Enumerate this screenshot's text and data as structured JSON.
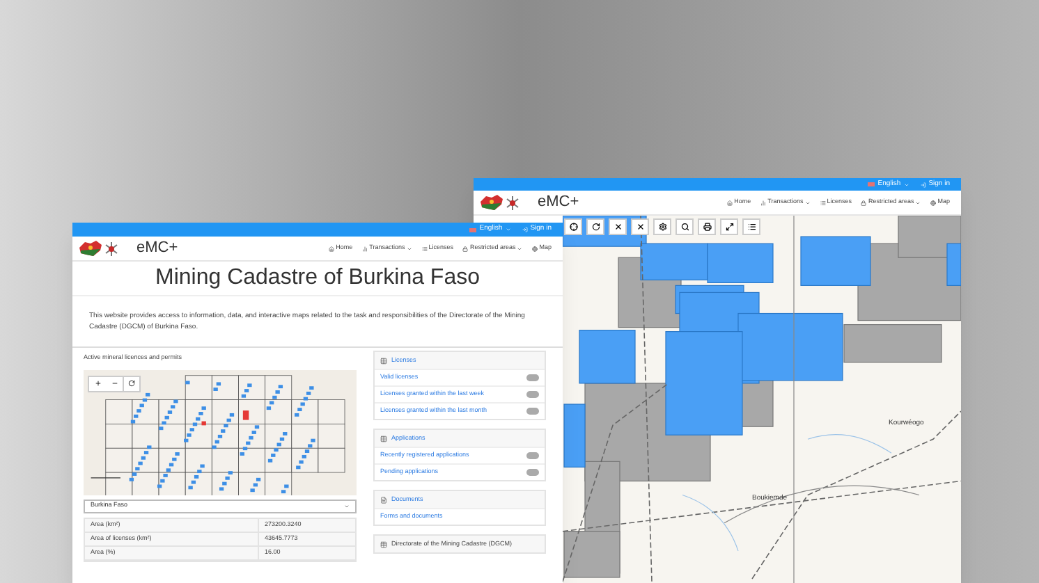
{
  "back_window": {
    "topbar": {
      "language": "English",
      "sign_in": "Sign in"
    },
    "brand": "eMC+",
    "nav": [
      {
        "label": "Home",
        "dropdown": false
      },
      {
        "label": "Transactions",
        "dropdown": true
      },
      {
        "label": "Licenses",
        "dropdown": false
      },
      {
        "label": "Restricted areas",
        "dropdown": true
      },
      {
        "label": "Map",
        "dropdown": false
      }
    ],
    "map_labels": [
      "Boukiemde",
      "Kourwéogo"
    ]
  },
  "front_window": {
    "topbar": {
      "language": "English",
      "sign_in": "Sign in"
    },
    "brand": "eMC+",
    "nav": [
      {
        "label": "Home",
        "dropdown": false
      },
      {
        "label": "Transactions",
        "dropdown": true
      },
      {
        "label": "Licenses",
        "dropdown": false
      },
      {
        "label": "Restricted areas",
        "dropdown": true
      },
      {
        "label": "Map",
        "dropdown": false
      }
    ],
    "title": "Mining Cadastre of Burkina Faso",
    "description": "This website provides access to information, data, and interactive maps related to the task and responsibilities of the Directorate of the Mining Cadastre (DGCM) of Burkina Faso.",
    "map_panel": {
      "title": "Active mineral licences and permits",
      "region_select": "Burkina Faso",
      "table": [
        {
          "label": "Area (km²)",
          "value": "273200.3240"
        },
        {
          "label": "Area of licenses (km²)",
          "value": "43645.7773"
        },
        {
          "label": "Area (%)",
          "value": "16.00"
        }
      ]
    },
    "panels": [
      {
        "title": "Licenses",
        "links": [
          {
            "label": "Valid licenses",
            "badge": true
          },
          {
            "label": "Licenses granted within the last week",
            "badge": true
          },
          {
            "label": "Licenses granted within the last month",
            "badge": true
          }
        ]
      },
      {
        "title": "Applications",
        "links": [
          {
            "label": "Recently registered applications",
            "badge": true
          },
          {
            "label": "Pending applications",
            "badge": true
          }
        ]
      },
      {
        "title": "Documents",
        "links": [
          {
            "label": "Forms and documents",
            "badge": false
          }
        ]
      },
      {
        "title": "Directorate of the Mining Cadastre (DGCM)"
      }
    ]
  }
}
